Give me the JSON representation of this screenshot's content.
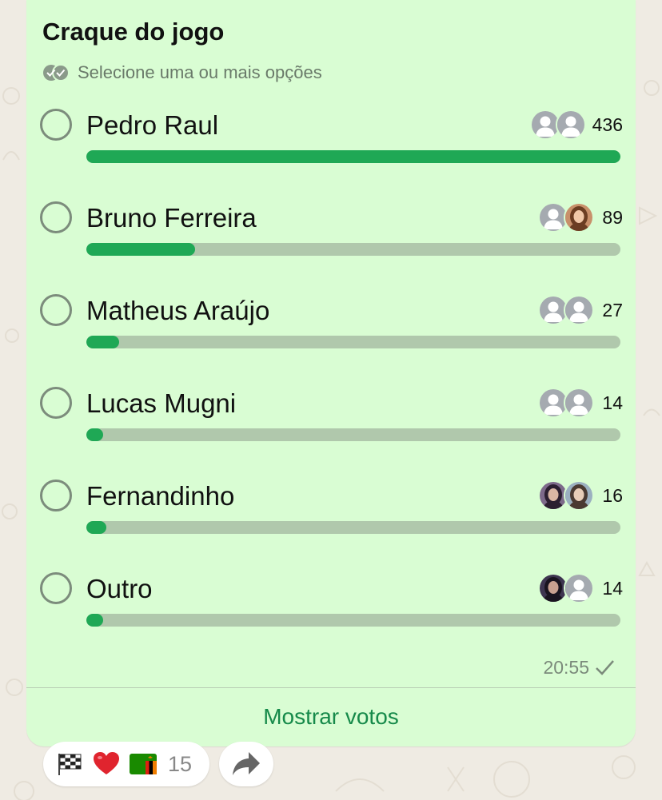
{
  "poll": {
    "title": "Craque do jogo",
    "subtitle": "Selecione uma ou mais opções",
    "options": [
      {
        "label": "Pedro Raul",
        "votes": "436",
        "progress": 1.0,
        "voters": [
          "default-avatar",
          "default-avatar"
        ]
      },
      {
        "label": "Bruno Ferreira",
        "votes": "89",
        "progress": 0.204,
        "voters": [
          "default-avatar",
          "photo-avatar"
        ]
      },
      {
        "label": "Matheus Araújo",
        "votes": "27",
        "progress": 0.062,
        "voters": [
          "default-avatar",
          "default-avatar"
        ]
      },
      {
        "label": "Lucas Mugni",
        "votes": "14",
        "progress": 0.032,
        "voters": [
          "default-avatar",
          "default-avatar"
        ]
      },
      {
        "label": "Fernandinho",
        "votes": "16",
        "progress": 0.037,
        "voters": [
          "photo-avatar",
          "photo-avatar"
        ]
      },
      {
        "label": "Outro",
        "votes": "14",
        "progress": 0.032,
        "voters": [
          "photo-avatar",
          "default-avatar"
        ]
      }
    ],
    "time": "20:55",
    "show_votes_label": "Mostrar votos"
  },
  "reactions": {
    "emojis": [
      "checkered-flag-emoji",
      "red-heart-emoji",
      "zambia-flag-emoji"
    ],
    "count": "15"
  },
  "icons": {
    "double-check": "double-check-icon",
    "read-check": "checkmark-icon",
    "forward": "forward-arrow-icon"
  },
  "colors": {
    "bubble": "#d9fdd3",
    "bar_fill": "#1fa855",
    "bar_track": "#b0c8ac",
    "link": "#168a4a"
  }
}
